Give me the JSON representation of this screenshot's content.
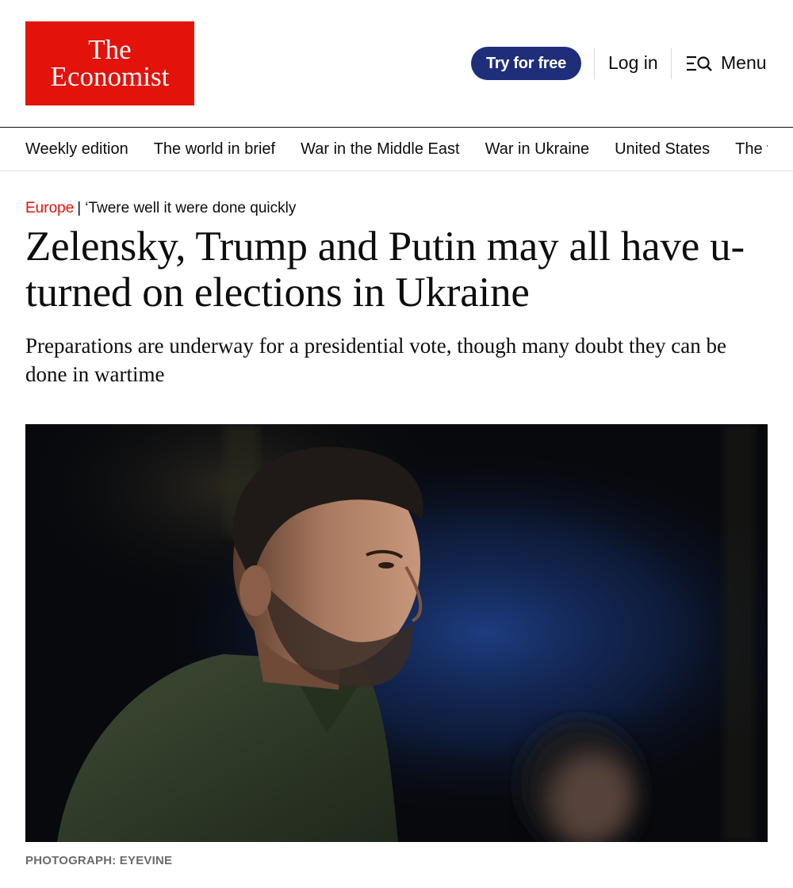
{
  "header": {
    "logo_line1": "The",
    "logo_line2": "Economist",
    "try_label": "Try for free",
    "login_label": "Log in",
    "menu_label": "Menu"
  },
  "nav": {
    "items": [
      "Weekly edition",
      "The world in brief",
      "War in the Middle East",
      "War in Ukraine",
      "United States",
      "The world economy"
    ]
  },
  "article": {
    "section": "Europe",
    "rubric_separator": "|",
    "fly_title": "‘Twere well it were done quickly",
    "headline": "Zelensky, Trump and Putin may all have u-turned on elections in Ukraine",
    "standfirst": "Preparations are underway for a presidential vote, though many doubt they can be done in wartime",
    "photo_caption": "PHOTOGRAPH: EYEVINE"
  },
  "colors": {
    "brand_red": "#e3120b",
    "button_navy": "#1f2e7a",
    "text": "#0d0d0d",
    "caption_grey": "#6b6b6b"
  },
  "icons": {
    "menu": "menu-search-icon"
  }
}
